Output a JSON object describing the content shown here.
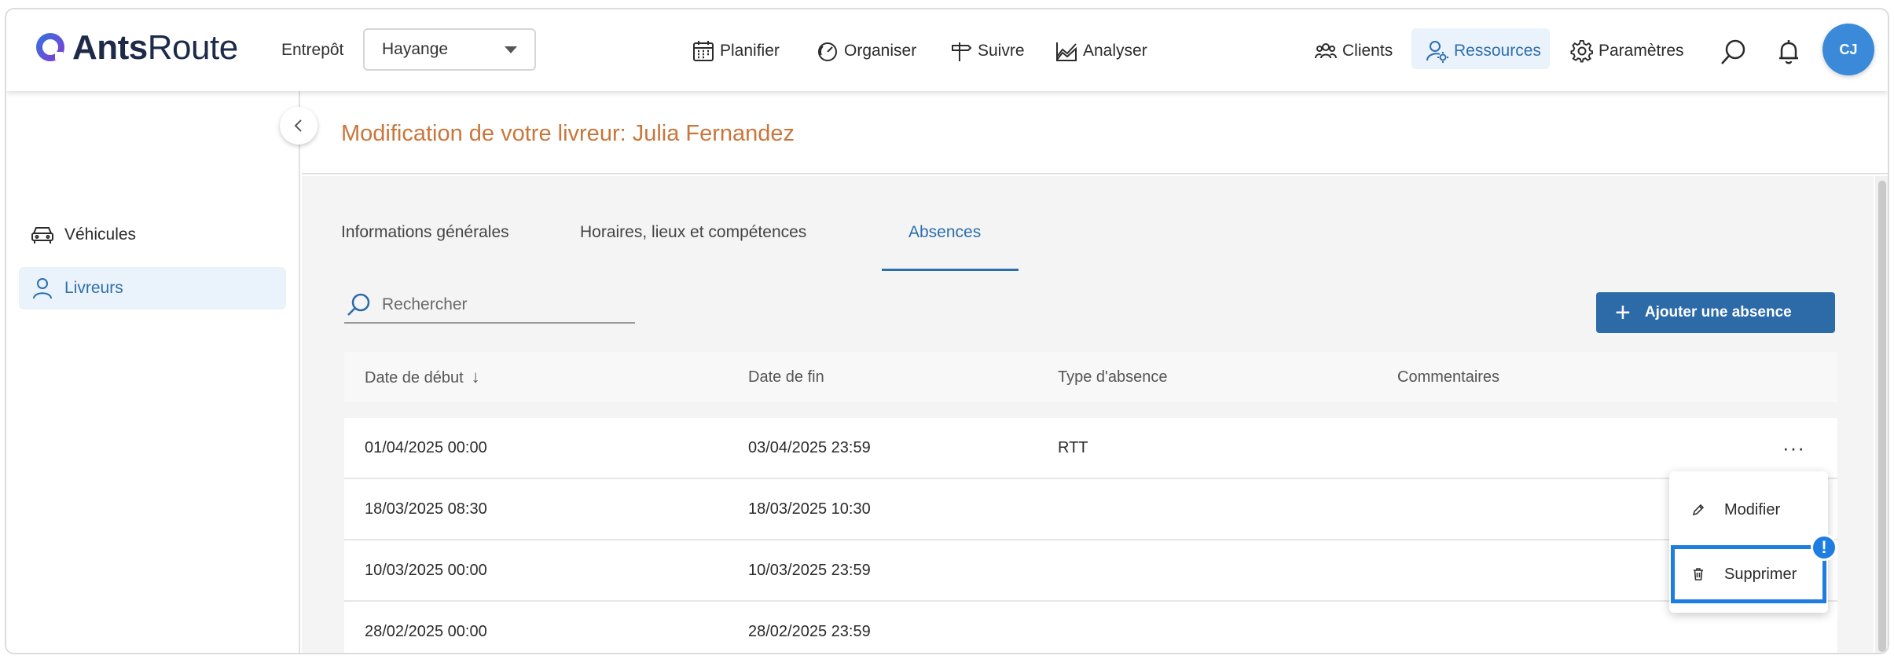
{
  "app": {
    "logo_bold": "Ants",
    "logo_regular": "Route"
  },
  "header": {
    "warehouse_label": "Entrepôt",
    "warehouse_value": "Hayange",
    "nav": [
      {
        "label": "Planifier",
        "icon": "calendar-icon"
      },
      {
        "label": "Organiser",
        "icon": "gauge-icon"
      },
      {
        "label": "Suivre",
        "icon": "signpost-icon"
      },
      {
        "label": "Analyser",
        "icon": "chart-icon"
      }
    ],
    "right_nav": [
      {
        "label": "Clients",
        "icon": "clients-icon"
      },
      {
        "label": "Ressources",
        "icon": "resources-icon",
        "active": true
      },
      {
        "label": "Paramètres",
        "icon": "gear-icon"
      }
    ],
    "avatar_initials": "CJ"
  },
  "sidebar": {
    "items": [
      {
        "label": "Véhicules",
        "icon": "car-icon"
      },
      {
        "label": "Livreurs",
        "icon": "user-icon",
        "active": true
      }
    ]
  },
  "page": {
    "title": "Modification de votre livreur: Julia Fernandez"
  },
  "tabs": [
    {
      "label": "Informations générales"
    },
    {
      "label": "Horaires, lieux et compétences"
    },
    {
      "label": "Absences",
      "active": true
    }
  ],
  "search": {
    "placeholder": "Rechercher"
  },
  "add_button": {
    "label": "Ajouter une absence"
  },
  "table": {
    "headers": [
      "Date de début",
      "Date de fin",
      "Type d'absence",
      "Commentaires"
    ],
    "rows": [
      {
        "start": "01/04/2025 00:00",
        "end": "03/04/2025 23:59",
        "type": "RTT",
        "comment": ""
      },
      {
        "start": "18/03/2025 08:30",
        "end": "18/03/2025 10:30",
        "type": "",
        "comment": ""
      },
      {
        "start": "10/03/2025 00:00",
        "end": "10/03/2025 23:59",
        "type": "",
        "comment": ""
      },
      {
        "start": "28/02/2025 00:00",
        "end": "28/02/2025 23:59",
        "type": "",
        "comment": ""
      }
    ],
    "more_label": "···"
  },
  "context_menu": {
    "items": [
      {
        "label": "Modifier",
        "icon": "pencil-icon"
      },
      {
        "label": "Supprimer",
        "icon": "trash-icon",
        "highlighted": true
      }
    ],
    "badge": "!"
  },
  "colors": {
    "accent": "#2c6fae",
    "title": "#c9763a",
    "button": "#2c6aa8",
    "highlight": "#1e7de0",
    "avatar": "#3b8ad9"
  }
}
